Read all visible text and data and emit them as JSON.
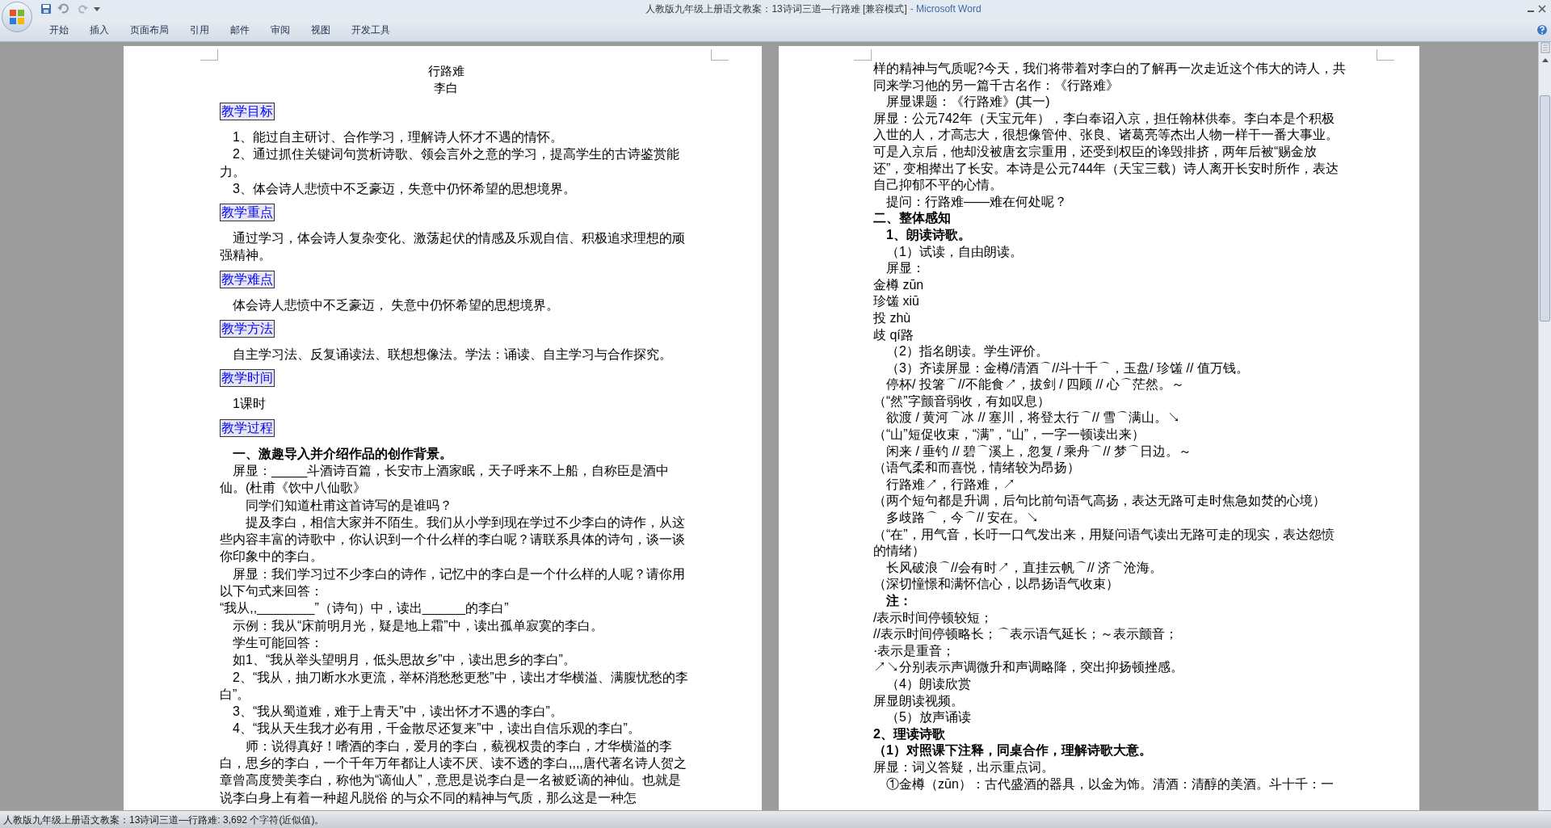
{
  "window": {
    "title": "人教版九年级上册语文教案：13诗词三道—行路难 [兼容模式]",
    "app_name": "- Microsoft Word"
  },
  "ribbon_tabs": [
    "开始",
    "插入",
    "页面布局",
    "引用",
    "邮件",
    "审阅",
    "视图",
    "开发工具"
  ],
  "left_page": {
    "paragraphs": [
      {
        "kind": "title",
        "text": "行路难"
      },
      {
        "kind": "author",
        "text": "李白"
      },
      {
        "kind": "label",
        "text": "教学目标"
      },
      {
        "kind": "text",
        "text": "1、能过自主研讨、合作学习，理解诗人怀才不遇的情怀。"
      },
      {
        "kind": "text",
        "text": "2、通过抓住关键词句赏析诗歌、领会言外之意的学习，提高学生的古诗鉴赏能力。"
      },
      {
        "kind": "text",
        "text": "3、体会诗人悲愤中不乏豪迈，失意中仍怀希望的思想境界。"
      },
      {
        "kind": "label",
        "text": "教学重点"
      },
      {
        "kind": "text",
        "text": "通过学习，体会诗人复杂变化、激荡起伏的情感及乐观自信、积极追求理想的顽强精神。"
      },
      {
        "kind": "label",
        "text": "教学难点"
      },
      {
        "kind": "text",
        "text": "体会诗人悲愤中不乏豪迈， 失意中仍怀希望的思想境界。"
      },
      {
        "kind": "label",
        "text": "教学方法"
      },
      {
        "kind": "text",
        "text": "自主学习法、反复诵读法、联想想像法。学法：诵读、自主学习与合作探究。"
      },
      {
        "kind": "label",
        "text": "教学时间"
      },
      {
        "kind": "text",
        "text": "1课时"
      },
      {
        "kind": "label",
        "text": "教学过程"
      },
      {
        "kind": "bold",
        "text": "一、激趣导入并介绍作品的创作背景。"
      },
      {
        "kind": "text",
        "text": "屏显：_____斗酒诗百篇，长安市上酒家眠，天子呼来不上船，自称臣是酒中仙。(杜甫《饮中八仙歌》"
      },
      {
        "kind": "text-deep",
        "text": "同学们知道杜甫这首诗写的是谁吗？"
      },
      {
        "kind": "text-deep",
        "text": "提及李白，相信大家并不陌生。我们从小学到现在学过不少李白的诗作，从这些内容丰富的诗歌中，你认识到一个什么样的李白呢？请联系具体的诗句，谈一谈你印象中的李白。"
      },
      {
        "kind": "text",
        "text": "屏显：我们学习过不少李白的诗作，记忆中的李白是一个什么样的人呢？请你用以下句式来回答："
      },
      {
        "kind": "text-flush",
        "text": "“我从,,________”（诗句）中，读出______的李白”"
      },
      {
        "kind": "text",
        "text": "示例：我从“床前明月光，疑是地上霜”中，读出孤单寂寞的李白。"
      },
      {
        "kind": "text",
        "text": "学生可能回答："
      },
      {
        "kind": "text",
        "text": "如1、“我从举头望明月，低头思故乡”中，读出思乡的李白”。"
      },
      {
        "kind": "text",
        "text": "2、“我从，抽刀断水水更流，举杯消愁愁更愁”中，读出才华横溢、满腹忧愁的李白”。"
      },
      {
        "kind": "text",
        "text": "3、“我从蜀道难，难于上青天”中，读出怀才不遇的李白”。"
      },
      {
        "kind": "text",
        "text": "4、“我从天生我才必有用，千金散尽还复来”中，读出自信乐观的李白”。"
      },
      {
        "kind": "text-deep",
        "text": "师：说得真好！嗜酒的李白，爱月的李白，藐视权贵的李白，才华横溢的李白，思乡的李白，一个千年万年都让人读不厌、读不透的李白,,,,唐代著名诗人贺之章曾高度赞美李白，称他为“谪仙人”，意思是说李白是一名被贬谪的神仙。也就是说李白身上有着一种超凡脱俗 的与众不同的精神与气质，那么这是一种怎"
      }
    ]
  },
  "right_page": {
    "paragraphs": [
      {
        "kind": "text-flush",
        "text": "样的精神与气质呢?今天，我们将带着对李白的了解再一次走近这个伟大的诗人，共同来学习他的另一篇千古名作：《行路难》"
      },
      {
        "kind": "text",
        "text": "屏显课题：《行路难》(其一)"
      },
      {
        "kind": "text-flush",
        "text": "屏显：公元742年（天宝元年），李白奉诏入京，担任翰林供奉。李白本是个积极入世的人，才高志大，很想像管仲、张良、诸葛亮等杰出人物一样干一番大事业。可是入京后，他却没被唐玄宗重用，还受到权臣的谗毁排挤，两年后被“赐金放还”，变相撵出了长安。本诗是公元744年（天宝三载）诗人离开长安时所作，表达自己抑郁不平的心情。"
      },
      {
        "kind": "text",
        "text": "提问：行路难——难在何处呢？"
      },
      {
        "kind": "bold-flush",
        "text": "二、整体感知"
      },
      {
        "kind": "bold",
        "text": "1、朗读诗歌。"
      },
      {
        "kind": "text",
        "text": "（1）试读，自由朗读。"
      },
      {
        "kind": "text",
        "text": "屏显："
      },
      {
        "kind": "text-flush",
        "text": "金樽 zūn"
      },
      {
        "kind": "text-flush",
        "text": "珍馐 xiū"
      },
      {
        "kind": "text-flush",
        "text": "投 zhù"
      },
      {
        "kind": "text-flush",
        "text": "歧 qí路"
      },
      {
        "kind": "text",
        "text": "（2）指名朗读。学生评价。"
      },
      {
        "kind": "text",
        "text": "（3）齐读屏显：金樽/清酒⌒//斗十千⌒，玉盘/ 珍馐 // 值万钱。"
      },
      {
        "kind": "text",
        "text": "停杯/ 投箸⌒//不能食↗，拔剑 / 四顾 // 心⌒茫然。～"
      },
      {
        "kind": "text-flush",
        "text": "（“然”字颤音弱收，有如叹息）"
      },
      {
        "kind": "text",
        "text": "欲渡 / 黄河⌒冰 // 塞川，将登太行⌒// 雪⌒满山。↘"
      },
      {
        "kind": "text-flush",
        "text": "（“山”短促收束，“满”，“山”，一字一顿读出来）"
      },
      {
        "kind": "text",
        "text": "闲来 / 垂钓 // 碧⌒溪上，忽复 / 乘舟⌒// 梦⌒日边。～"
      },
      {
        "kind": "text-flush",
        "text": "（语气柔和而喜悦，情绪较为昂扬）"
      },
      {
        "kind": "text",
        "text": "行路难↗，行路难，↗"
      },
      {
        "kind": "text-flush",
        "text": "（两个短句都是升调，后句比前句语气高扬，表达无路可走时焦急如焚的心境）"
      },
      {
        "kind": "text",
        "text": "多歧路⌒，今⌒// 安在。↘"
      },
      {
        "kind": "text-flush",
        "text": "（“在”，用气音，长吁一口气发出来，用疑问语气读出无路可走的现实，表达怨愤的情绪）"
      },
      {
        "kind": "text",
        "text": "长风破浪⌒//会有时↗，直挂云帆⌒// 济⌒沧海。"
      },
      {
        "kind": "text-flush",
        "text": "（深切憧憬和满怀信心，以昂扬语气收束）"
      },
      {
        "kind": "bold",
        "text": "注："
      },
      {
        "kind": "text-flush",
        "text": "/表示时间停顿较短；"
      },
      {
        "kind": "text-flush",
        "text": "//表示时间停顿略长；⌒表示语气延长；～表示颤音；"
      },
      {
        "kind": "text-flush",
        "text": "·表示是重音；"
      },
      {
        "kind": "text-flush",
        "text": "↗↘分别表示声调微升和声调略降，突出抑扬顿挫感。"
      },
      {
        "kind": "text",
        "text": "（4）朗读欣赏"
      },
      {
        "kind": "text-flush",
        "text": "屏显朗读视频。"
      },
      {
        "kind": "text",
        "text": "（5）放声诵读"
      },
      {
        "kind": "bold-flush",
        "text": "2、理读诗歌"
      },
      {
        "kind": "bold-flush",
        "text": "（1）对照课下注释，同桌合作，理解诗歌大意。"
      },
      {
        "kind": "text-flush",
        "text": "屏显：词义答疑，出示重点词。"
      },
      {
        "kind": "text",
        "text": "①金樽（zūn）：古代盛酒的器具，以金为饰。清酒：清醇的美酒。斗十千：一"
      }
    ]
  },
  "status_bar": {
    "text": "人教版九年级上册语文教案：13诗词三道—行路难: 3,692 个字符(近似值)。"
  }
}
